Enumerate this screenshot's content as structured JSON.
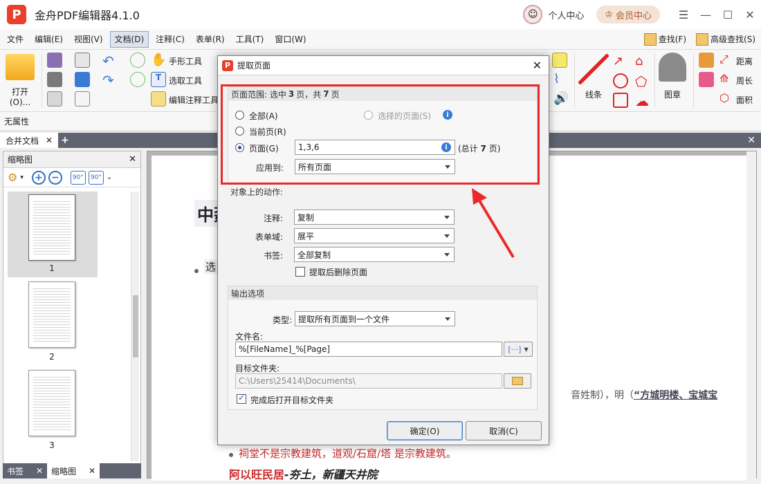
{
  "app": {
    "logo_letter": "P",
    "title": "金舟PDF编辑器4.1.0",
    "user_center": "个人中心",
    "vip_center": "会员中心"
  },
  "menu": [
    "文件",
    "编辑(E)",
    "视图(V)",
    "文档(D)",
    "注释(C)",
    "表单(R)",
    "工具(T)",
    "窗口(W)"
  ],
  "menu_right": {
    "find": "查找(F)",
    "advanced_find": "高级查找(S)"
  },
  "ribbon": {
    "open": "打开(O)...",
    "hand_tool": "手形工具",
    "select_tool": "选取工具",
    "edit_annot_tool": "编辑注释工具",
    "line": "线条",
    "stamp": "图章",
    "distance": "距离",
    "perimeter": "周长",
    "area": "面积"
  },
  "property_bar": "无属性",
  "tabs": {
    "doc_tab": "合并文档"
  },
  "side_panel": {
    "title": "缩略图",
    "thumbs": [
      "1",
      "2",
      "3"
    ],
    "bottom_tabs": [
      "书签",
      "缩略图"
    ]
  },
  "document": {
    "heading": "中孬",
    "line1": "选",
    "right_text_prefix": "音姓制），明（",
    "right_text_bold": "“方城明楼、宝城宝",
    "red_line": "祠堂不是宗教建筑，道观/石窟/塔 是宗教建筑。",
    "bold_red": "阿以旺民居",
    "bold_rest": "-夯土，新疆天井院"
  },
  "dialog": {
    "title": "提取页面",
    "range_group": {
      "title_prefix": "页面范围: 选中",
      "selected": "3",
      "title_mid": "页，共",
      "total": "7",
      "title_suffix": "页",
      "all": "全部(A)",
      "selected_pages": "选择的页面(S)",
      "current": "当前页(R)",
      "pages": "页面(G)",
      "pages_value": "1,3,6",
      "total_note_prefix": "(总计",
      "total_note_num": "7",
      "total_note_suffix": "页)",
      "apply_to_label": "应用到:",
      "apply_to_value": "所有页面"
    },
    "action_group": {
      "title": "对象上的动作:",
      "annot_label": "注释:",
      "annot_value": "复制",
      "form_label": "表单域:",
      "form_value": "展平",
      "bookmark_label": "书签:",
      "bookmark_value": "全部复制",
      "delete_after": "提取后删除页面"
    },
    "output_group": {
      "title": "输出选项",
      "type_label": "类型:",
      "type_value": "提取所有页面到一个文件",
      "filename_label": "文件名:",
      "filename_value": "%[FileName]_%[Page]",
      "filename_btn": "[···]",
      "folder_label": "目标文件夹:",
      "folder_value": "C:\\Users\\25414\\Documents\\",
      "open_after": "完成后打开目标文件夹"
    },
    "ok": "确定(O)",
    "cancel": "取消(C)"
  },
  "colors": {
    "accent_red": "#e82a2a",
    "brand": "#e8402b"
  }
}
